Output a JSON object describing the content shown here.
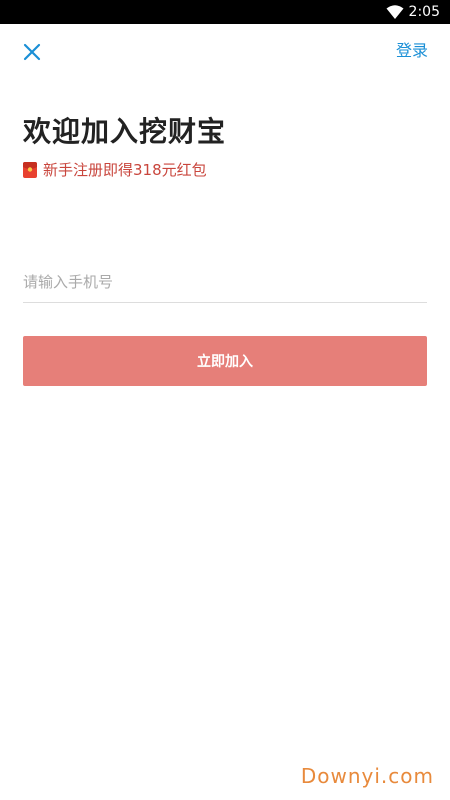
{
  "status_bar": {
    "time": "2:05",
    "icons": [
      "wifi-icon"
    ]
  },
  "header": {
    "close_icon": "close-icon",
    "login_label": "登录"
  },
  "main": {
    "title": "欢迎加入挖财宝",
    "promo_icon": "red-packet-icon",
    "promo_text": "新手注册即得318元红包",
    "phone_input": {
      "value": "",
      "placeholder": "请输入手机号"
    },
    "join_button_label": "立即加入"
  },
  "watermark": "Downyi.com",
  "colors": {
    "accent_blue": "#1a8fd6",
    "promo_red": "#c9463d",
    "button_pink": "#e67f79",
    "watermark_orange": "#e88a3c"
  }
}
